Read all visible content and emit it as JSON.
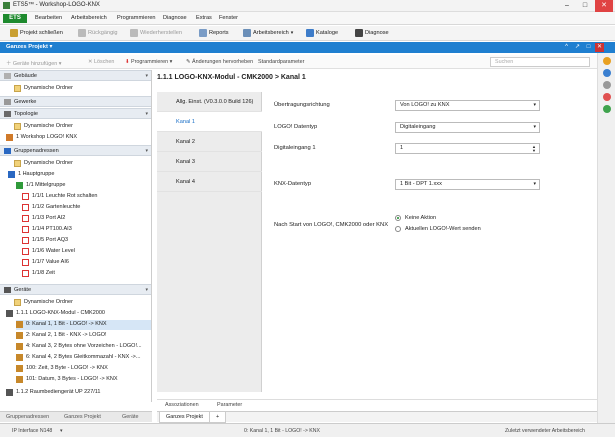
{
  "window": {
    "title": "ETS5™ - Workshop-LOGO-KNX",
    "controls": [
      "–",
      "□",
      "✕"
    ]
  },
  "menu": {
    "app_badge": "ETS",
    "items": [
      "Bearbeiten",
      "Arbeitsbereich",
      "Programmieren",
      "Diagnose",
      "Extras",
      "Fenster"
    ]
  },
  "toolbar": {
    "close_project": "Projekt schließen",
    "undo": "Rückgängig",
    "redo": "Wiederherstellen",
    "reports": "Reports",
    "workspace": "Arbeitsbereich",
    "catalogs": "Kataloge",
    "diagnostics": "Diagnose"
  },
  "project_bar": {
    "label": "Ganzes Projekt",
    "buttons": [
      "^",
      "↗",
      "□",
      "✕"
    ]
  },
  "panel_toolbar": {
    "add_devices": "Geräte hinzufügen",
    "delete": "Löschen",
    "program": "Programmieren",
    "highlight_changes": "Änderungen hervorheben",
    "default_params": "Standardparameter",
    "search_placeholder": "Suchen"
  },
  "tree": {
    "sections": {
      "buildings": "Gebäude",
      "trades": "Gewerke",
      "topology": "Topologie",
      "group_addresses": "Gruppenadressen",
      "devices": "Geräte"
    },
    "buildings_items": [
      "Dynamische Ordner"
    ],
    "topology_items": [
      "Dynamische Ordner",
      "1 Workshop LOGO! KNX"
    ],
    "group_items": {
      "dynamic": "Dynamische Ordner",
      "main_group": "1 Hauptgruppe",
      "middle_group": "1/1 Mittelgruppe",
      "addresses": [
        "1/1/1 Leuchte Rot schalten",
        "1/1/2 Gartenleuchte",
        "1/1/3 Port AI2",
        "1/1/4 PT100.AI3",
        "1/1/5 Port AQ3",
        "1/1/6 Water Level",
        "1/1/7 Value AI6",
        "1/1/8 Zeit"
      ]
    },
    "device_items": {
      "dynamic": "Dynamische Ordner",
      "device": "1.1.1 LOGO-KNX-Modul - CMK2000",
      "objects": [
        "0: Kanal 1, 1 Bit - LOGO! -> KNX",
        "2: Kanal 2, 1 Bit - KNX -> LOGO!",
        "4: Kanal 3, 2 Bytes ohne Vorzeichen - LOGO!...",
        "6: Kanal 4, 2 Bytes Gleitkommazahl - KNX ->...",
        "100: Zeit, 3 Byte - LOGO! -> KNX",
        "101: Datum, 3 Bytes - LOGO! -> KNX"
      ],
      "device2": "1.1.2 Raumbediengerät UP 227/11"
    }
  },
  "tree_bottom_tabs": [
    "Gruppenadressen",
    "Ganzes Projekt",
    "Geräte"
  ],
  "main": {
    "breadcrumb": "1.1.1 LOGO-KNX-Modul - CMK2000 > Kanal 1",
    "tabs": [
      "Allg. Einst. (V0.3.0.0 Build 126)",
      "Kanal 1",
      "Kanal 2",
      "Kanal 3",
      "Kanal 4"
    ],
    "fields": {
      "direction_label": "Übertragungsrichtung",
      "direction_value": "Von LOGO! zu KNX",
      "logo_type_label": "LOGO! Datentyp",
      "logo_type_value": "Digitaleingang",
      "digital_input_label": "Digitaleingang 1",
      "digital_input_value": "1",
      "knx_type_label": "KNX-Datentyp",
      "knx_type_value": "1 Bit - DPT 1.xxx",
      "restart_label": "Nach Start von LOGO!, CMK2000 oder KNX",
      "restart_opt1": "Keine Aktion",
      "restart_opt2": "Aktuellen LOGO!-Wert senden"
    },
    "subtabs": [
      "Assoziationen",
      "Parameter"
    ],
    "doc_tab": "Ganzes Projekt",
    "doc_tab_add": "+"
  },
  "status": {
    "interface": "IP Interface N148",
    "selected": "0: Kanal 1, 1 Bit - LOGO! -> KNX",
    "workspace": "Zuletzt verwendeter Arbeitsbereich"
  },
  "colors": {
    "accent": "#1f7fd0",
    "ets_green": "#1e8a2e"
  }
}
